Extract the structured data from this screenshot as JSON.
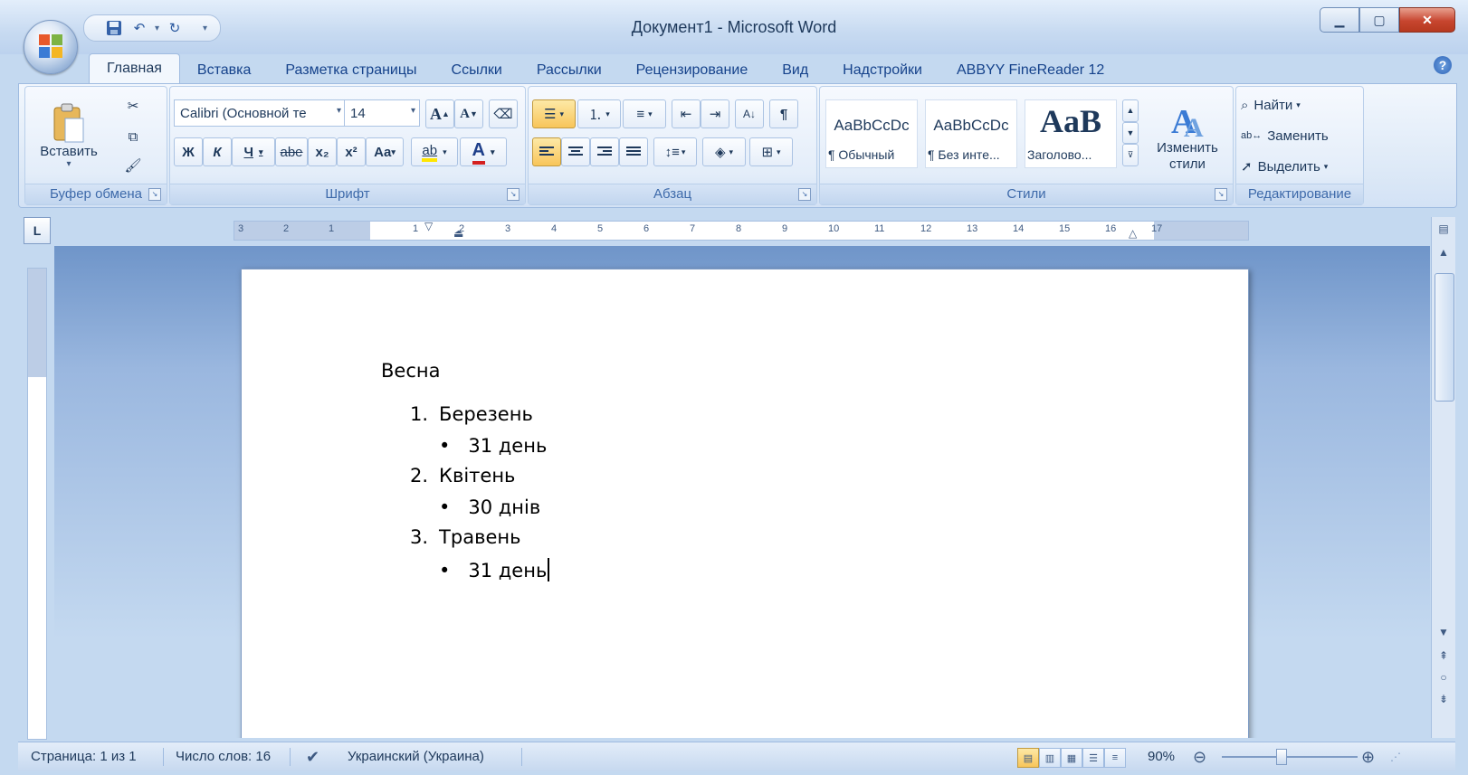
{
  "window": {
    "title": "Документ1 - Microsoft Word"
  },
  "tabs": [
    "Главная",
    "Вставка",
    "Разметка страницы",
    "Ссылки",
    "Рассылки",
    "Рецензирование",
    "Вид",
    "Надстройки",
    "ABBYY FineReader 12"
  ],
  "active_tab": "Главная",
  "ribbon": {
    "clipboard": {
      "label": "Буфер обмена",
      "paste": "Вставить"
    },
    "font": {
      "label": "Шрифт",
      "font_name": "Calibri (Основной те",
      "font_size": "14",
      "bold": "Ж",
      "italic": "К",
      "underline": "Ч",
      "strike": "abe",
      "subscript": "x₂",
      "superscript": "x²",
      "case": "Aa",
      "grow": "A",
      "shrink": "A",
      "color_letter": "A",
      "highlight": "ab"
    },
    "paragraph": {
      "label": "Абзац",
      "pilcrow": "¶"
    },
    "styles": {
      "label": "Стили",
      "items": [
        {
          "sample": "AaBbCcDc",
          "name": "¶ Обычный"
        },
        {
          "sample": "AaBbCcDc",
          "name": "¶ Без инте..."
        },
        {
          "sample": "AaB",
          "name": "Заголово..."
        }
      ],
      "change": "Изменить стили"
    },
    "editing": {
      "label": "Редактирование",
      "find": "Найти",
      "replace": "Заменить",
      "select": "Выделить"
    }
  },
  "ruler": {
    "corner": "L",
    "numbers": [
      "3",
      "2",
      "1",
      "1",
      "2",
      "3",
      "4",
      "5",
      "6",
      "7",
      "8",
      "9",
      "10",
      "11",
      "12",
      "13",
      "14",
      "15",
      "16",
      "17"
    ]
  },
  "document": {
    "heading": "Весна",
    "items": [
      {
        "num": "1.",
        "text": "Березень",
        "sub": "31 день"
      },
      {
        "num": "2.",
        "text": "Квітень",
        "sub": "30 днів"
      },
      {
        "num": "3.",
        "text": "Травень",
        "sub": "31 день"
      }
    ]
  },
  "status": {
    "page": "Страница: 1 из 1",
    "words": "Число слов: 16",
    "language": "Украинский (Украина)",
    "zoom": "90%"
  }
}
